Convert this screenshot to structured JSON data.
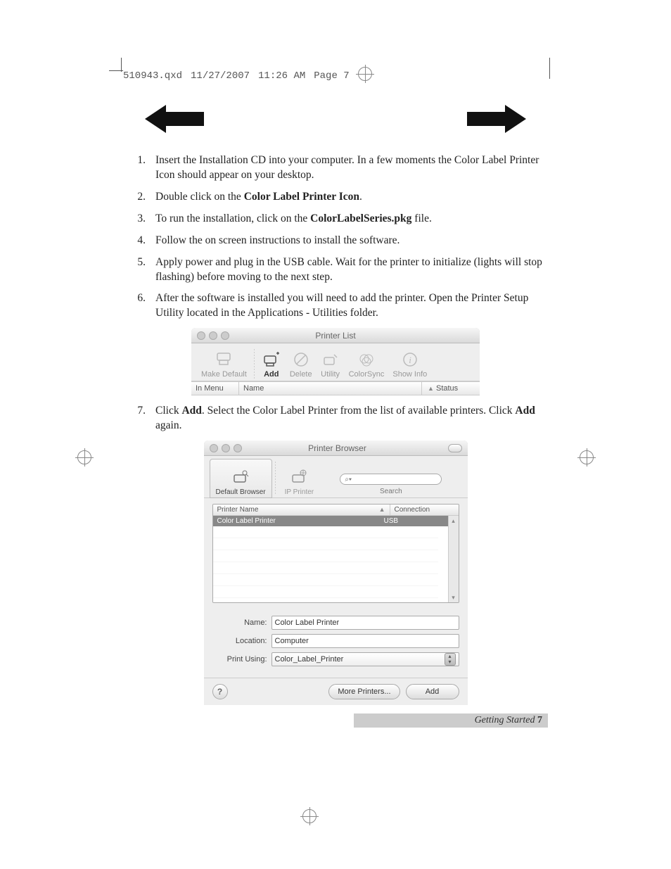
{
  "slug": {
    "file": "510943.qxd",
    "date": "11/27/2007",
    "time": "11:26 AM",
    "page_label": "Page 7"
  },
  "steps": [
    {
      "n": "1.",
      "pre": "Insert the Installation CD into your computer. In a few moments the Color Label Printer Icon should appear on your desktop."
    },
    {
      "n": "2.",
      "pre": "Double click on the ",
      "bold": "Color Label Printer Icon",
      "post": "."
    },
    {
      "n": "3.",
      "pre": "To run the installation, click on the ",
      "bold": "ColorLabelSeries.pkg",
      "post": " file."
    },
    {
      "n": "4.",
      "pre": "Follow the on screen instructions to install the software."
    },
    {
      "n": "5.",
      "pre": "Apply power and plug in the USB cable.  Wait for the printer to initialize (lights will stop flashing) before moving to the next step."
    },
    {
      "n": "6.",
      "pre": "After the software is installed you will need to add the printer.  Open the Printer Setup Utility located in the Applications - Utilities folder."
    }
  ],
  "step7": {
    "n": "7.",
    "pre": "Click ",
    "bold1": "Add",
    "mid": ".  Select the Color Label Printer from the list of available printers. Click ",
    "bold2": "Add",
    "post": " again."
  },
  "printerList": {
    "title": "Printer List",
    "tools": {
      "makeDefault": "Make Default",
      "add": "Add",
      "delete": "Delete",
      "utility": "Utility",
      "colorsync": "ColorSync",
      "showInfo": "Show Info"
    },
    "columns": {
      "inMenu": "In Menu",
      "name": "Name",
      "status": "Status"
    }
  },
  "printerBrowser": {
    "title": "Printer Browser",
    "tabs": {
      "default": "Default Browser",
      "ip": "IP Printer"
    },
    "searchLabel": "Search",
    "listHeaders": {
      "printerName": "Printer Name",
      "connection": "Connection"
    },
    "listRow": {
      "name": "Color Label Printer",
      "connection": "USB"
    },
    "form": {
      "nameLabel": "Name:",
      "nameValue": "Color Label Printer",
      "locationLabel": "Location:",
      "locationValue": "Computer",
      "printUsingLabel": "Print Using:",
      "printUsingValue": "Color_Label_Printer"
    },
    "buttons": {
      "more": "More Printers...",
      "add": "Add"
    }
  },
  "footer": {
    "section": "Getting Started",
    "page": "7"
  }
}
